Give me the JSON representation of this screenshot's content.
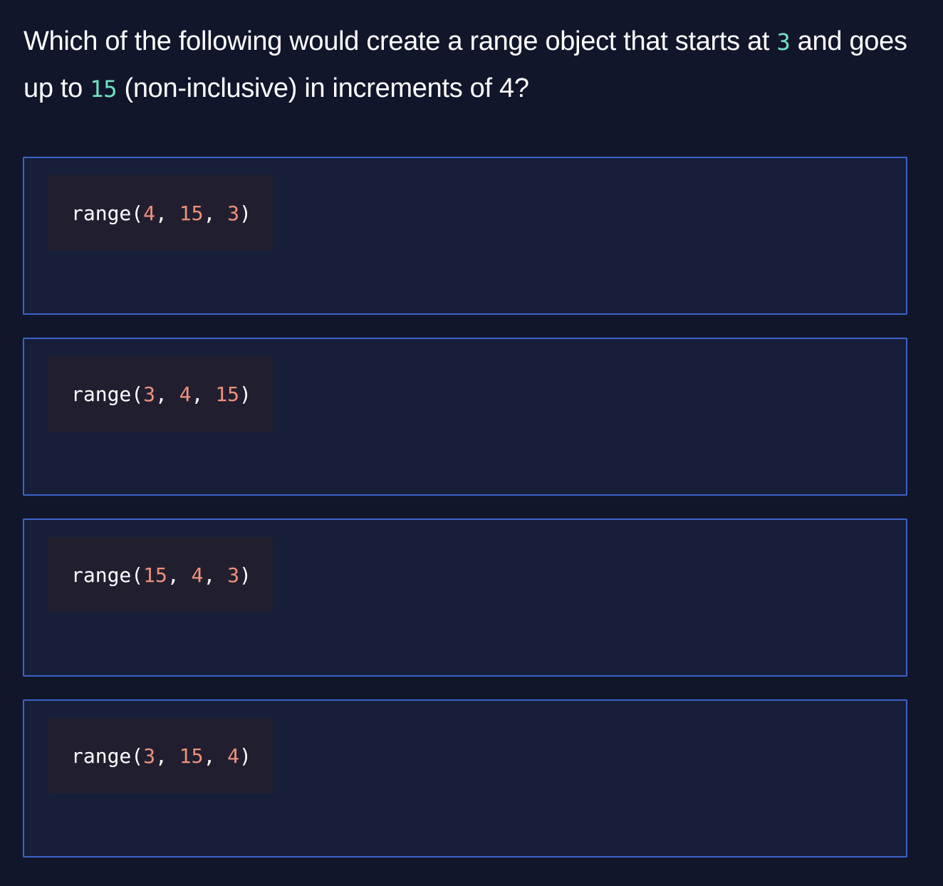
{
  "question": {
    "part1": "Which of the following would create a range object that starts at ",
    "start": "3",
    "part2": " and goes up to ",
    "stop": "15",
    "part3": " (non-inclusive) in increments of 4?"
  },
  "options": [
    {
      "fn": "range(",
      "a": "4",
      "sep1": ", ",
      "b": "15",
      "sep2": ", ",
      "c": "3",
      "close": ")"
    },
    {
      "fn": "range(",
      "a": "3",
      "sep1": ", ",
      "b": "4",
      "sep2": ", ",
      "c": "15",
      "close": ")"
    },
    {
      "fn": "range(",
      "a": "15",
      "sep1": ", ",
      "b": "4",
      "sep2": ", ",
      "c": "3",
      "close": ")"
    },
    {
      "fn": "range(",
      "a": "3",
      "sep1": ", ",
      "b": "15",
      "sep2": ", ",
      "c": "4",
      "close": ")"
    }
  ],
  "colors": {
    "background": "#12162b",
    "option_background": "#171e3a",
    "option_border": "#3a64c8",
    "code_background": "#211f2f",
    "number_highlight": "#f0917a",
    "question_highlight": "#6fe3c2"
  }
}
